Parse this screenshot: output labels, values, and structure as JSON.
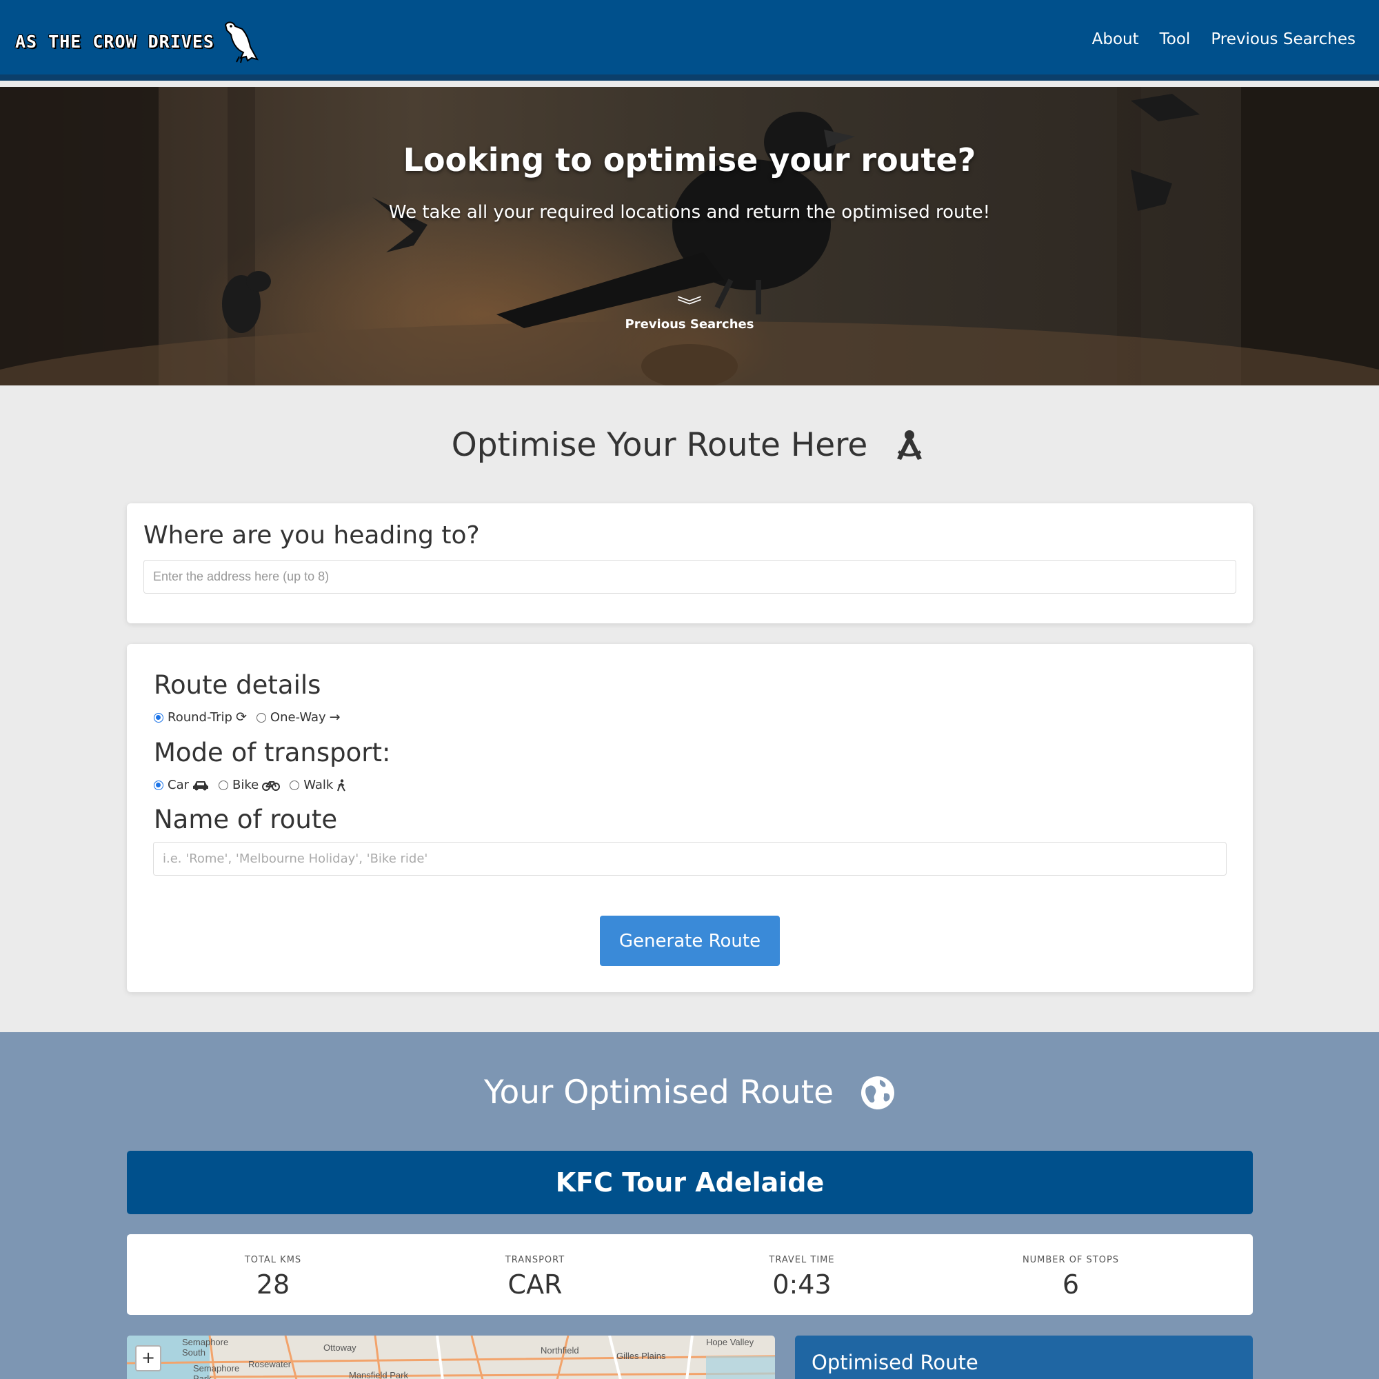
{
  "header": {
    "brand": "AS THE CROW DRIVES",
    "nav": [
      "About",
      "Tool",
      "Previous Searches"
    ]
  },
  "hero": {
    "title": "Looking to optimise your route?",
    "subtitle": "We take all your required locations and return the optimised route!",
    "prev_label": "Previous Searches"
  },
  "optimise": {
    "title": "Optimise Your Route Here",
    "destination": {
      "heading": "Where are you heading to?",
      "placeholder": "Enter the address here (up to 8)",
      "value": ""
    },
    "route_details": {
      "heading": "Route details",
      "options": [
        {
          "label": "Round-Trip",
          "checked": true,
          "icon": "sync-icon"
        },
        {
          "label": "One-Way",
          "checked": false,
          "icon": "arrow-right-icon"
        }
      ]
    },
    "transport": {
      "heading": "Mode of transport:",
      "options": [
        {
          "label": "Car",
          "checked": true,
          "icon": "car-icon"
        },
        {
          "label": "Bike",
          "checked": false,
          "icon": "bicycle-icon"
        },
        {
          "label": "Walk",
          "checked": false,
          "icon": "walking-icon"
        }
      ]
    },
    "route_name": {
      "heading": "Name of route",
      "placeholder": "i.e. 'Rome', 'Melbourne Holiday', 'Bike ride'",
      "value": ""
    },
    "generate_label": "Generate Route"
  },
  "result": {
    "title": "Your Optimised Route",
    "route_name": "KFC Tour Adelaide",
    "stats": [
      {
        "label": "TOTAL KMS",
        "value": "28"
      },
      {
        "label": "TRANSPORT",
        "value": "CAR"
      },
      {
        "label": "TRAVEL TIME",
        "value": "0:43"
      },
      {
        "label": "NUMBER OF STOPS",
        "value": "6"
      }
    ],
    "map_labels": [
      "Semaphore South",
      "Ottoway",
      "Rosewater",
      "Semaphore Park",
      "Mansfield Park",
      "Northfield",
      "Gilles Plains",
      "Hope Valley"
    ],
    "zoom_in": "+",
    "panel_title": "Optimised Route"
  },
  "colors": {
    "navbar": "#00508c",
    "button": "#3a8ad8",
    "result_bg": "#7d96b3"
  }
}
